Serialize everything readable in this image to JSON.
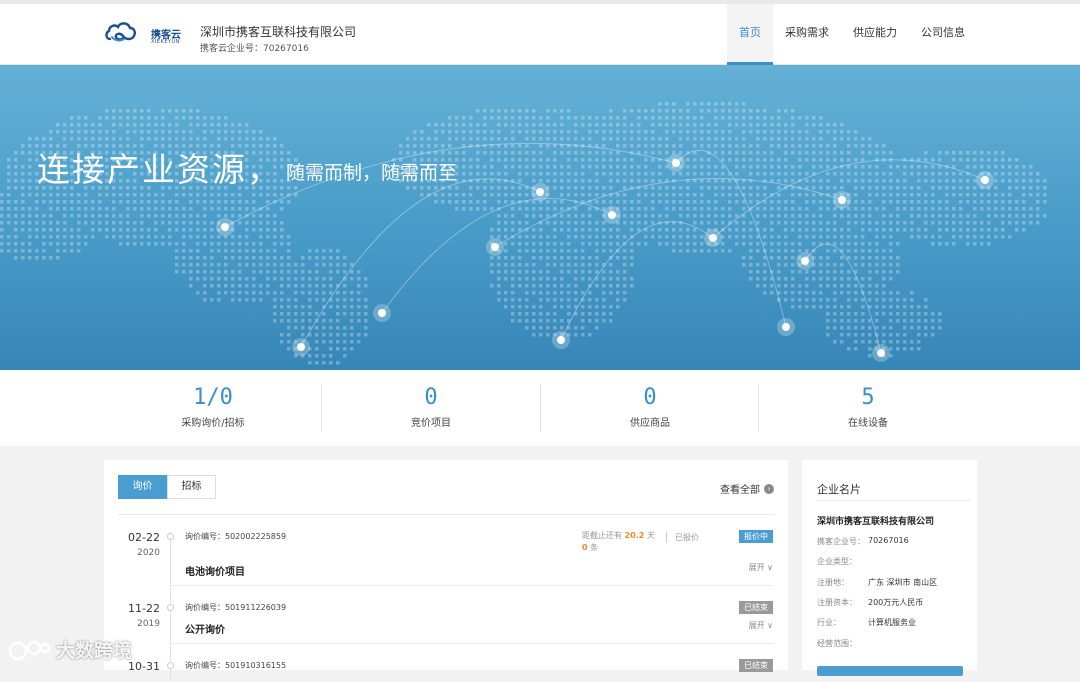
{
  "header": {
    "logo_text": "携客云",
    "logo_sub": "XIEKEYUN",
    "company_name": "深圳市携客互联科技有限公司",
    "company_no": "携客云企业号：70267016",
    "nav": [
      "首页",
      "采购需求",
      "供应能力",
      "公司信息"
    ],
    "active_nav": "首页"
  },
  "hero": {
    "title": "连接产业资源，",
    "subtitle": "随需而制，随需而至"
  },
  "stats": [
    {
      "value": "1/0",
      "label": "采购询价/招标"
    },
    {
      "value": "0",
      "label": "竞价项目"
    },
    {
      "value": "0",
      "label": "供应商品"
    },
    {
      "value": "5",
      "label": "在线设备"
    }
  ],
  "main": {
    "tabs": [
      "询价",
      "招标"
    ],
    "active_tab": "询价",
    "view_all": "查看全部",
    "rows": [
      {
        "date": "02-22",
        "year": "2020",
        "no": "询价编号：502002225859",
        "title": "电池询价项目",
        "badge": "报价中",
        "deadline_prefix": "距截止还有",
        "deadline_days": "20.2",
        "deadline_unit": "天",
        "count": "0",
        "count_unit": "条",
        "quoted": "已报价",
        "expand": "展开 ∨"
      },
      {
        "date": "11-22",
        "year": "2019",
        "no": "询价编号：501911226039",
        "title": "公开询价",
        "badge": "已结束",
        "expand": "展开 ∨"
      },
      {
        "date": "10-31",
        "year": "",
        "no": "询价编号：501910316155",
        "title": "",
        "badge": "已结束",
        "expand": ""
      }
    ]
  },
  "side": {
    "title": "企业名片",
    "company": "深圳市携客互联科技有限公司",
    "rows": [
      {
        "label": "携客企业号：",
        "value": "70267016"
      },
      {
        "label": "企业类型：",
        "value": ""
      },
      {
        "label": "注册地：",
        "value": "广东 深圳市 南山区"
      },
      {
        "label": "注册资本：",
        "value": "200万元人民币"
      },
      {
        "label": "行业：",
        "value": "计算机服务业"
      },
      {
        "label": "经营范围：",
        "value": ""
      }
    ]
  },
  "watermark": "大数跨境",
  "colors": {
    "accent": "#3a8fc7",
    "hero_top": "#64b1d6",
    "hero_bottom": "#3686b7",
    "badge_active": "#4a9dd1",
    "badge_ended": "#9a9a9a",
    "highlight": "#f08a24"
  }
}
